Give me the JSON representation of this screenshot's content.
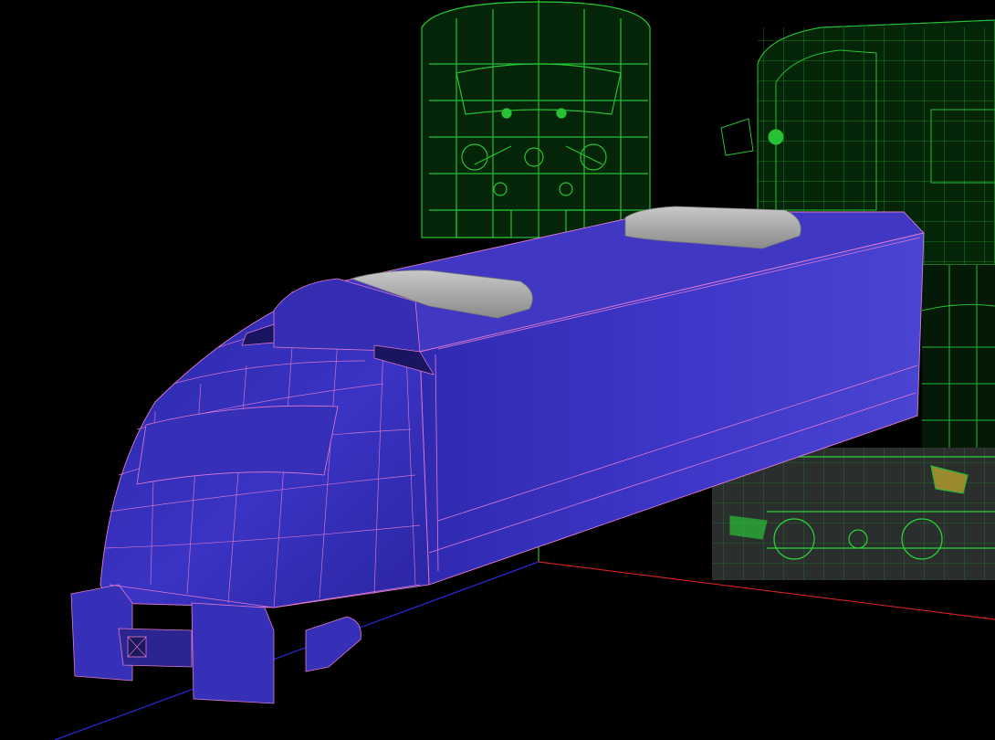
{
  "viewport": {
    "kind": "3d-modeling-perspective-viewport",
    "background_color": "#000000",
    "mesh_color": "#3a2fb5",
    "wireframe_color": "#e07ad0",
    "reference_color": "#2bd63a",
    "axis_colors": {
      "x": "#d42020",
      "y": "#25c025",
      "z": "#2a2adc"
    },
    "reference_images": [
      "front-view-blueprint",
      "side-view-blueprint",
      "lower-side-photo-reference"
    ],
    "model": "high-speed-train-nose-locomotive",
    "roof_parts_color": "#a8a8a8",
    "icons": [
      "grid-axis-icon"
    ]
  }
}
